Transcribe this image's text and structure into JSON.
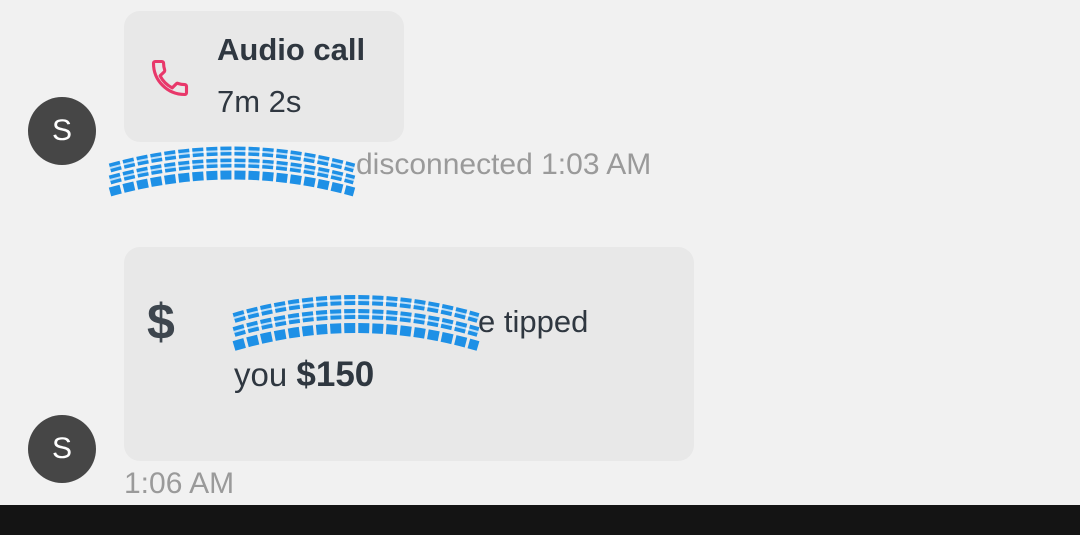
{
  "messages": [
    {
      "avatar_initial": "S",
      "call": {
        "title": "Audio call",
        "duration": "7m 2s",
        "icon": "phone-icon",
        "icon_color": "#e8386a"
      },
      "status": "disconnected 1:03 AM"
    },
    {
      "avatar_initial": "S",
      "tip": {
        "icon": "dollar-icon",
        "icon_glyph": "$",
        "text_suffix": "e tipped",
        "text_prefix": "you",
        "amount": "$150"
      },
      "time": "1:06 AM"
    }
  ],
  "redaction_color": "#1e90e6"
}
